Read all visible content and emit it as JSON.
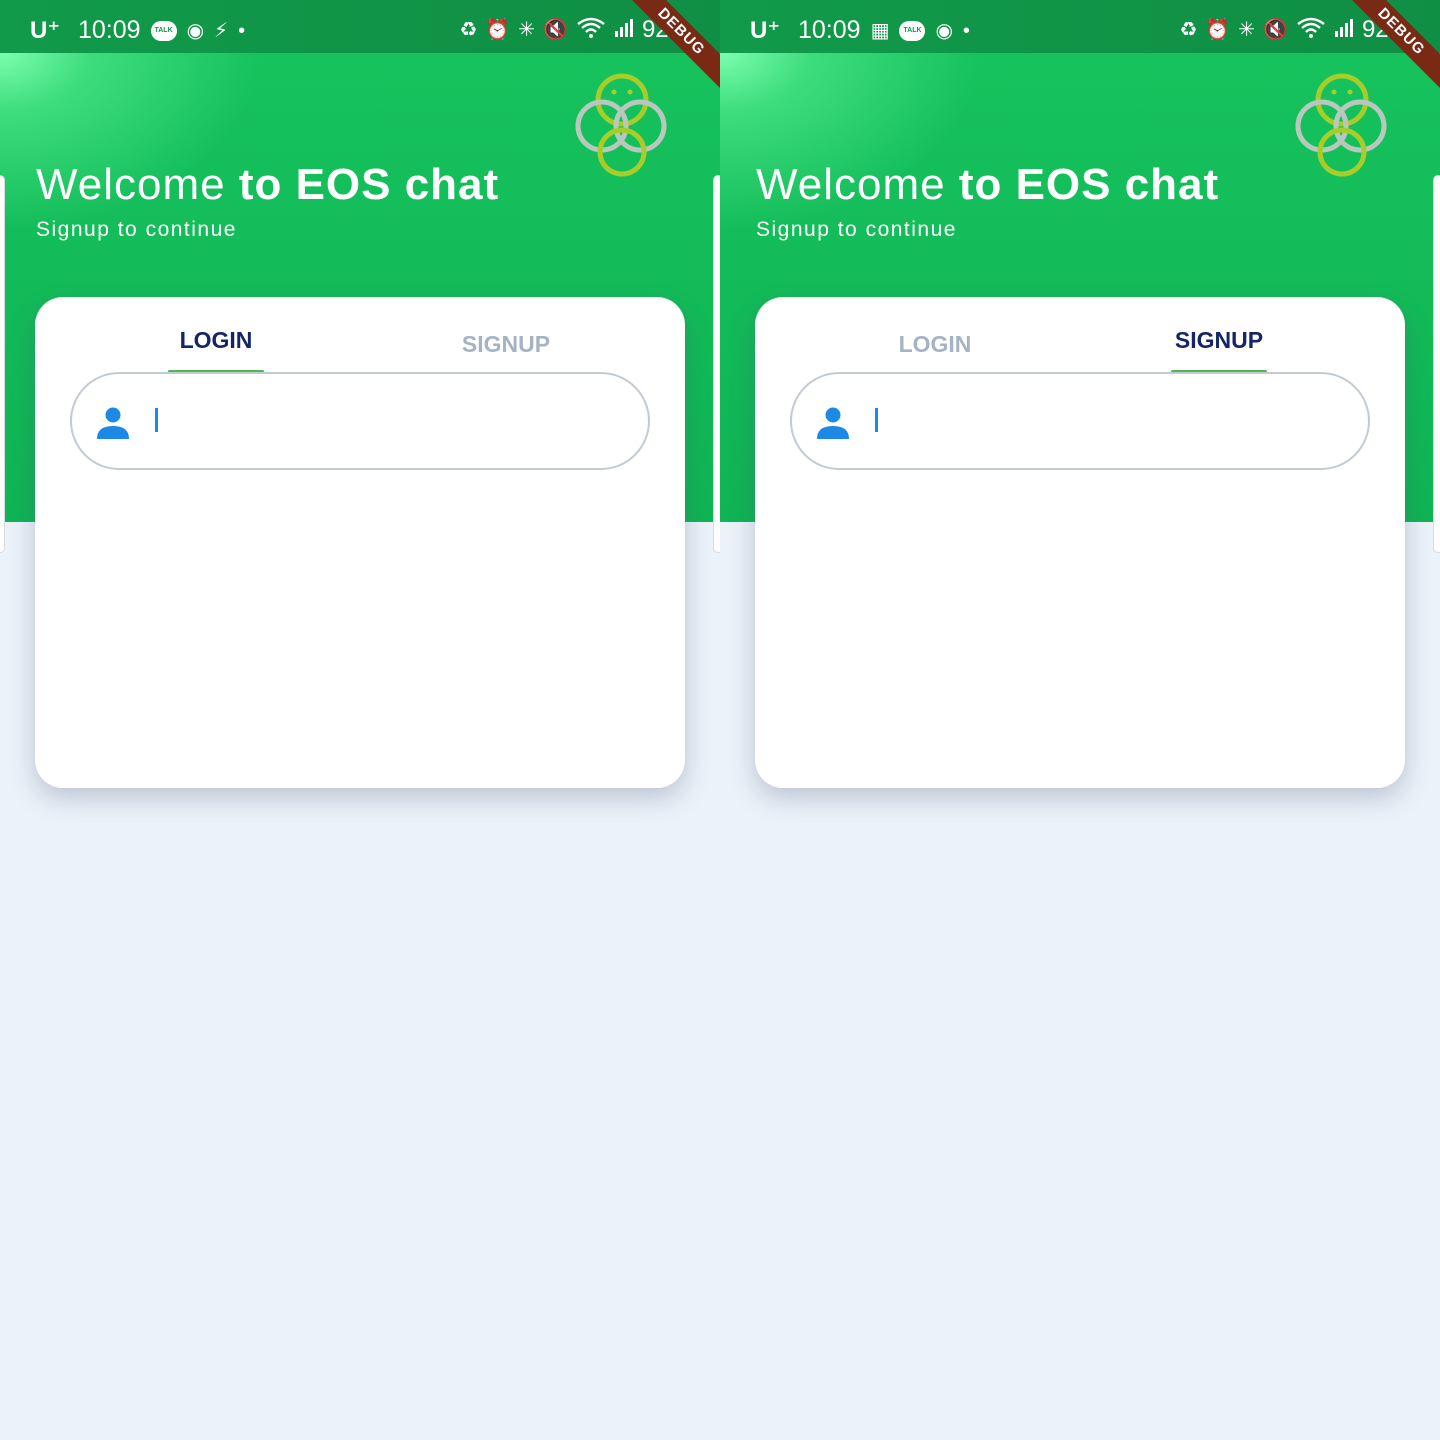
{
  "screens": [
    {
      "status": {
        "carrier": "U⁺",
        "time": "10:09",
        "battery": "92%",
        "debug": "DEBUG"
      },
      "welcome_light": "Welcome ",
      "welcome_bold": "to EOS chat",
      "subtitle": "Signup to continue",
      "tabs": [
        {
          "label": "LOGIN",
          "active": true
        },
        {
          "label": "SIGNUP",
          "active": false
        }
      ]
    },
    {
      "status": {
        "carrier": "U⁺",
        "time": "10:09",
        "battery": "92%",
        "debug": "DEBUG"
      },
      "welcome_light": "Welcome ",
      "welcome_bold": "to EOS chat",
      "subtitle": "Signup to continue",
      "tabs": [
        {
          "label": "LOGIN",
          "active": false
        },
        {
          "label": "SIGNUP",
          "active": true
        }
      ]
    }
  ],
  "icons": {
    "status_left_left": [
      "kakaotalk-icon",
      "location-icon",
      "charging-icon",
      "dot-icon"
    ],
    "status_left_right": [
      "gallery-icon",
      "kakaotalk-icon",
      "location-icon",
      "dot-icon"
    ],
    "status_right": [
      "battery-saver-icon",
      "alarm-icon",
      "bluetooth-icon",
      "mute-icon",
      "wifi-icon",
      "signal-icon"
    ],
    "field": "person-icon",
    "logo": "eos-chat-logo"
  },
  "colors": {
    "header_green": "#16c45e",
    "statusbar_green": "#119a4a",
    "active_tab": "#152565",
    "inactive_tab": "#a6b3c4",
    "tab_indicator": "#4eb84e",
    "accent_blue": "#1e88e5",
    "page_bg": "#ecf2fa"
  }
}
